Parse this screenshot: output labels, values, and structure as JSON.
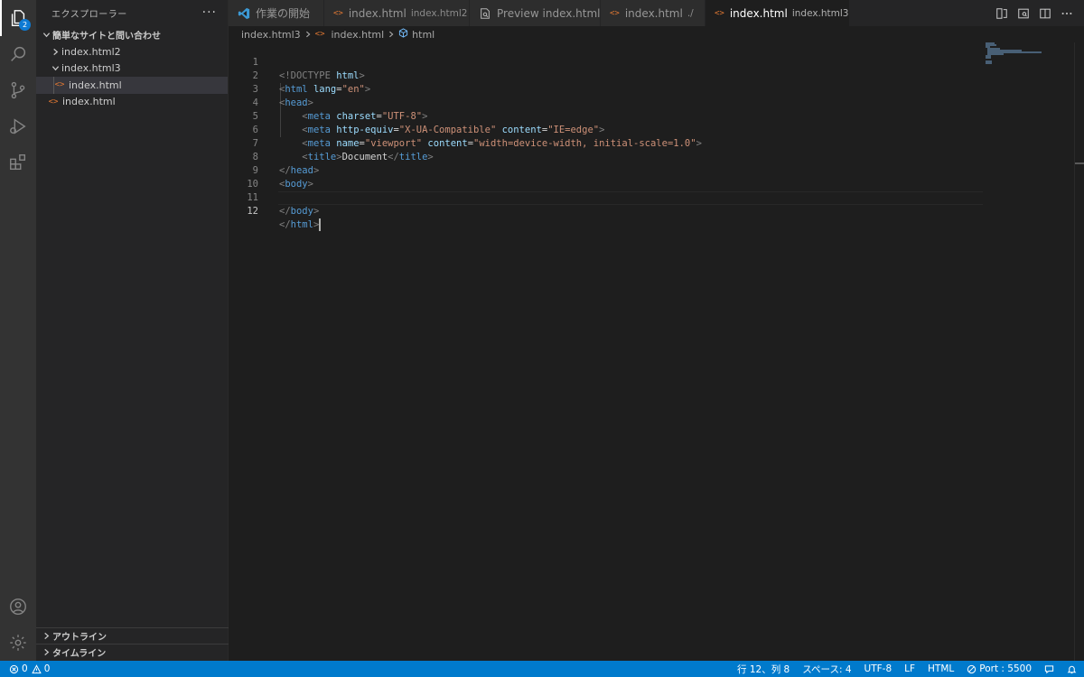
{
  "activity_bar": {
    "explorer_badge": "2",
    "items": [
      "explorer-icon",
      "search-icon",
      "source-control-icon",
      "run-debug-icon",
      "extensions-icon"
    ],
    "bottom": [
      "account-icon",
      "gear-icon"
    ]
  },
  "sidebar": {
    "title": "エクスプローラー",
    "more": "···",
    "workspace": "簡単なサイトと問い合わせ",
    "tree": [
      {
        "label": "index.html2",
        "type": "folder",
        "expanded": false
      },
      {
        "label": "index.html3",
        "type": "folder",
        "expanded": true
      },
      {
        "label": "index.html",
        "type": "file",
        "selected": true
      },
      {
        "label": "index.html",
        "type": "file"
      }
    ],
    "outline": "アウトライン",
    "timeline": "タイムライン"
  },
  "tabs": [
    {
      "label": "作業の開始",
      "desc": "",
      "icon": "vscode-logo-icon"
    },
    {
      "label": "index.html",
      "desc": "index.html2",
      "icon": "html-file-icon"
    },
    {
      "label": "Preview index.html",
      "desc": "",
      "icon": "preview-icon"
    },
    {
      "label": "index.html",
      "desc": "./",
      "icon": "html-file-icon",
      "dirty": true
    },
    {
      "label": "index.html",
      "desc": "index.html3",
      "icon": "html-file-icon",
      "dirty": true,
      "active": true
    }
  ],
  "breadcrumb": {
    "folder": "index.html3",
    "file": "index.html",
    "symbol": "html"
  },
  "editor": {
    "current_line": 12,
    "lines": [
      "1",
      "2",
      "3",
      "4",
      "5",
      "6",
      "7",
      "8",
      "9",
      "10",
      "11",
      "12"
    ],
    "code": {
      "doctype_open": "<!DOCTYPE ",
      "doctype_name": "html",
      "doctype_close": ">",
      "html_tag": "html",
      "lang_attr": "lang",
      "lang_val": "\"en\"",
      "head_tag": "head",
      "meta_tag": "meta",
      "charset_attr": "charset",
      "charset_val": "\"UTF-8\"",
      "http_equiv_attr": "http-equiv",
      "http_equiv_val": "\"X-UA-Compatible\"",
      "content_attr": "content",
      "content_val1": "\"IE=edge\"",
      "name_attr": "name",
      "name_val": "\"viewport\"",
      "content_val2": "\"width=device-width, initial-scale=1.0\"",
      "title_tag": "title",
      "title_text": "Document",
      "body_tag": "body"
    }
  },
  "statusbar": {
    "errors": "0",
    "warnings": "0",
    "position": "行 12、列 8",
    "spaces": "スペース: 4",
    "encoding": "UTF-8",
    "eol": "LF",
    "language": "HTML",
    "port": "Port : 5500"
  },
  "colors": {
    "accent": "#007acc",
    "html_icon": "#e37933",
    "tag": "#569cd6",
    "attr": "#9cdcfe",
    "string": "#ce9178"
  }
}
